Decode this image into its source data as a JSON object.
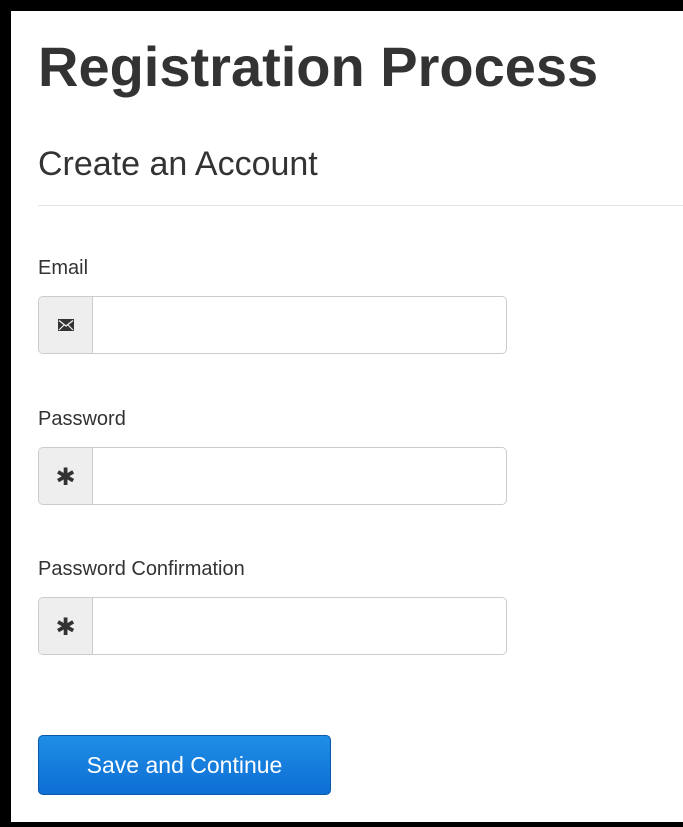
{
  "page": {
    "title": "Registration Process",
    "section_title": "Create an Account"
  },
  "form": {
    "email": {
      "label": "Email",
      "icon": "envelope-icon",
      "value": ""
    },
    "password": {
      "label": "Password",
      "icon": "asterisk-icon",
      "icon_glyph": "✱",
      "value": ""
    },
    "password_confirmation": {
      "label": "Password Confirmation",
      "icon": "asterisk-icon",
      "icon_glyph": "✱",
      "value": ""
    },
    "submit_label": "Save and Continue"
  },
  "colors": {
    "button": "#1478d8",
    "addon_background": "#eeeeee",
    "border": "#cccccc",
    "text": "#333333"
  }
}
